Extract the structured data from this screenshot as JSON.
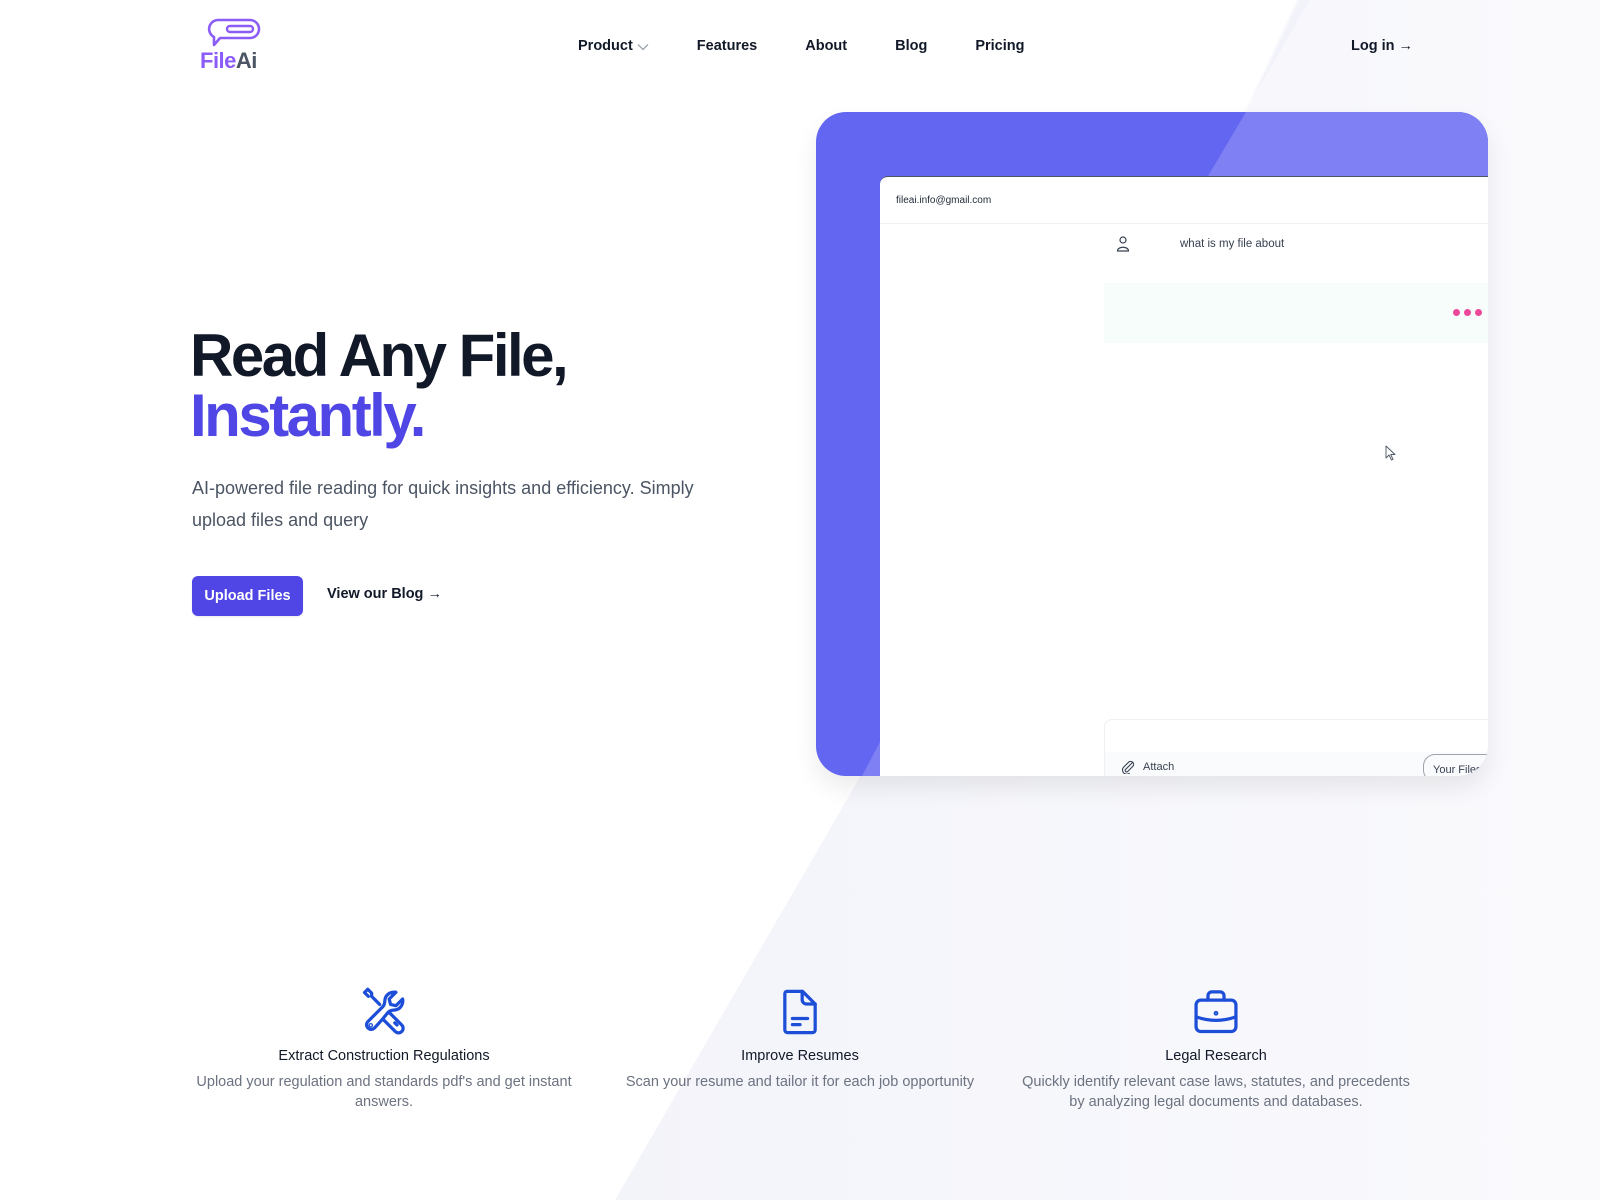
{
  "brand": {
    "name_part1": "File",
    "name_part2": "Ai",
    "colors": {
      "logo_purple": "#8b5cf6",
      "logo_gray": "#4b5563",
      "accent": "#4f46e5",
      "mockup_bg": "#6366f1",
      "loader_dot": "#ec4899",
      "feature_icon": "#1d4ed8"
    }
  },
  "nav": {
    "items": [
      {
        "label": "Product",
        "has_dropdown": true,
        "icon": "chevron-down-icon"
      },
      {
        "label": "Features"
      },
      {
        "label": "About"
      },
      {
        "label": "Blog"
      },
      {
        "label": "Pricing"
      }
    ],
    "login_label": "Log in →"
  },
  "hero": {
    "title_line1": "Read Any File,",
    "title_line2": "Instantly.",
    "subtitle": "AI-powered file reading for quick insights and efficiency. Simply upload files and query",
    "primary_button": "Upload Files",
    "secondary_link": "View our Blog →"
  },
  "mockup": {
    "account_email": "fileai.info@gmail.com",
    "user_message": "what is my file about",
    "user_icon": "user-icon",
    "reply_state": "loading",
    "attach_label": "Attach",
    "attach_icon": "paperclip-icon",
    "files_button": "Your Files"
  },
  "features": [
    {
      "icon": "wrench-screwdriver-icon",
      "title": "Extract Construction Regulations",
      "description": "Upload your regulation and standards pdf's and get instant answers."
    },
    {
      "icon": "document-icon",
      "title": "Improve Resumes",
      "description": "Scan your resume and tailor it for each job opportunity"
    },
    {
      "icon": "briefcase-icon",
      "title": "Legal Research",
      "description": "Quickly identify relevant case laws, statutes, and precedents by analyzing legal documents and databases."
    }
  ]
}
